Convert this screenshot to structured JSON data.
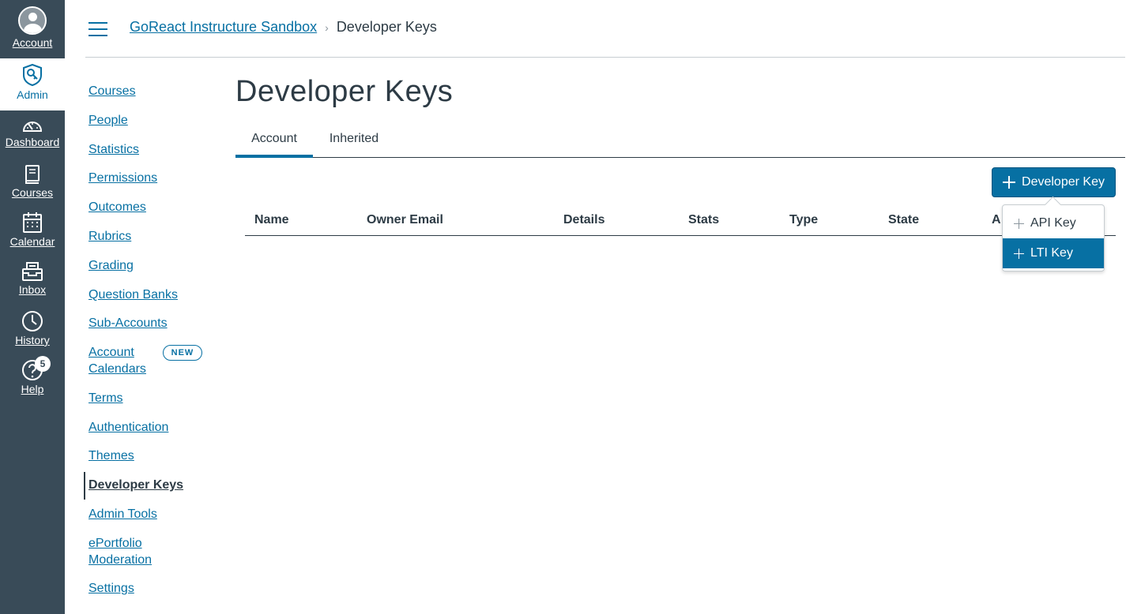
{
  "global_nav": {
    "account": "Account",
    "admin": "Admin",
    "dashboard": "Dashboard",
    "courses": "Courses",
    "calendar": "Calendar",
    "inbox": "Inbox",
    "history": "History",
    "help": "Help",
    "help_badge": "5"
  },
  "breadcrumb": {
    "parent": "GoReact Instructure Sandbox",
    "current": "Developer Keys"
  },
  "subnav": {
    "items": [
      "Courses",
      "People",
      "Statistics",
      "Permissions",
      "Outcomes",
      "Rubrics",
      "Grading",
      "Question Banks",
      "Sub-Accounts"
    ],
    "account_calendars_line1": "Account",
    "account_calendars_line2": "Calendars",
    "new_badge": "NEW",
    "items2": [
      "Terms",
      "Authentication",
      "Themes"
    ],
    "active": "Developer Keys",
    "items3": [
      "Admin Tools"
    ],
    "eportfolio_line1": "ePortfolio",
    "eportfolio_line2": "Moderation",
    "settings": "Settings"
  },
  "page": {
    "title": "Developer Keys",
    "tabs": [
      {
        "label": "Account"
      },
      {
        "label": "Inherited"
      }
    ],
    "add_button": "Developer Key",
    "columns": [
      "Name",
      "Owner Email",
      "Details",
      "Stats",
      "Type",
      "State",
      "A"
    ],
    "dropdown": [
      {
        "label": "API Key"
      },
      {
        "label": "LTI Key"
      }
    ]
  },
  "colors": {
    "nav_bg": "#394b58",
    "brand": "#0770a3",
    "text": "#2d3b45"
  }
}
